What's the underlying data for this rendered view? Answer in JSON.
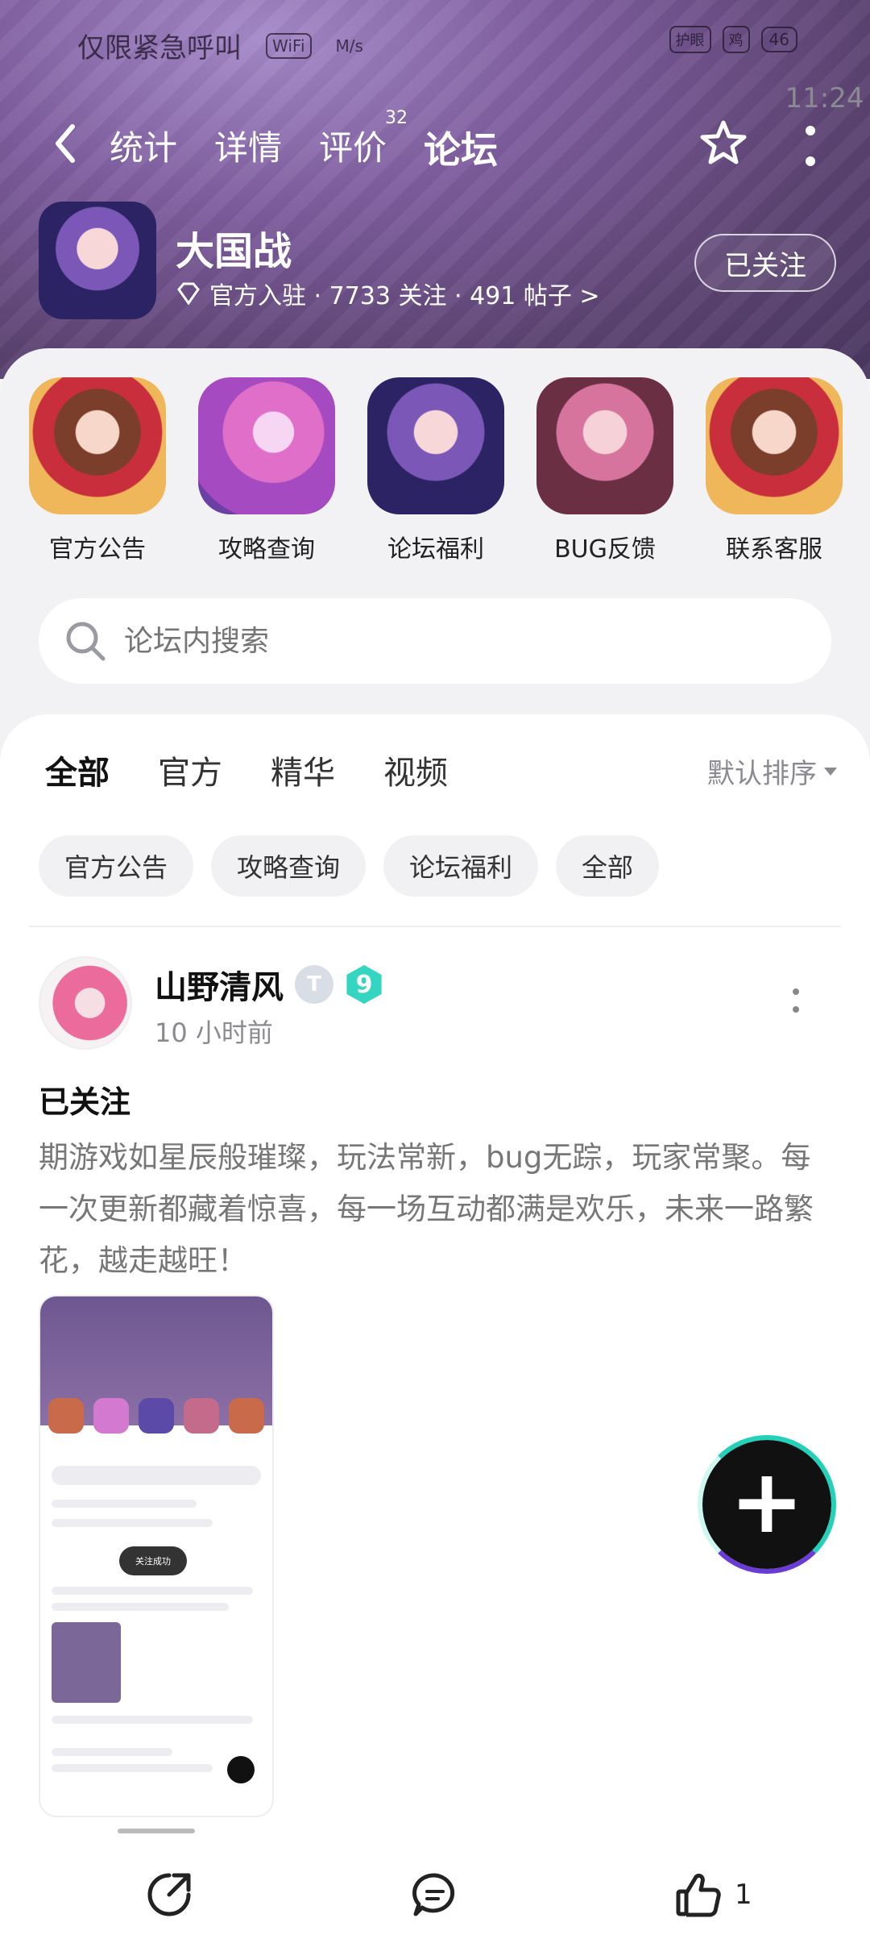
{
  "status_bar": {
    "carrier_text": "仅限紧急呼叫",
    "wifi": "WiFi",
    "speed": "M/s",
    "badges": [
      "护眼",
      "鸡"
    ],
    "battery": "46",
    "time": "11:24"
  },
  "nav": {
    "tabs": [
      {
        "label": "统计"
      },
      {
        "label": "详情"
      },
      {
        "label": "评价",
        "badge": "32"
      },
      {
        "label": "论坛"
      }
    ]
  },
  "game": {
    "title": "大国战",
    "meta": "官方入驻 · 7733 关注 · 491 帖子 >",
    "follow_label": "已关注"
  },
  "quick_entries": [
    {
      "label": "官方公告"
    },
    {
      "label": "攻略查询"
    },
    {
      "label": "论坛福利"
    },
    {
      "label": "BUG反馈"
    },
    {
      "label": "联系客服"
    }
  ],
  "search": {
    "placeholder": "论坛内搜索"
  },
  "feed_tabs": [
    "全部",
    "官方",
    "精华",
    "视频"
  ],
  "sort_label": "默认排序",
  "chips": [
    "官方公告",
    "攻略查询",
    "论坛福利",
    "全部"
  ],
  "post": {
    "author": "山野清风",
    "badge_t": "T",
    "level": "9",
    "time": "10 小时前",
    "tag": "已关注",
    "body": "期游戏如星辰般璀璨，玩法常新，bug无踪，玩家常聚。每一次更新都藏着惊喜，每一场互动都满是欢乐，未来一路繁花，越走越旺！",
    "thumb_toast": "关注成功"
  },
  "bottom_bar": {
    "like_count": "1"
  },
  "colors": {
    "accent": "#24d1b8",
    "hero": "#7f5e9f"
  }
}
